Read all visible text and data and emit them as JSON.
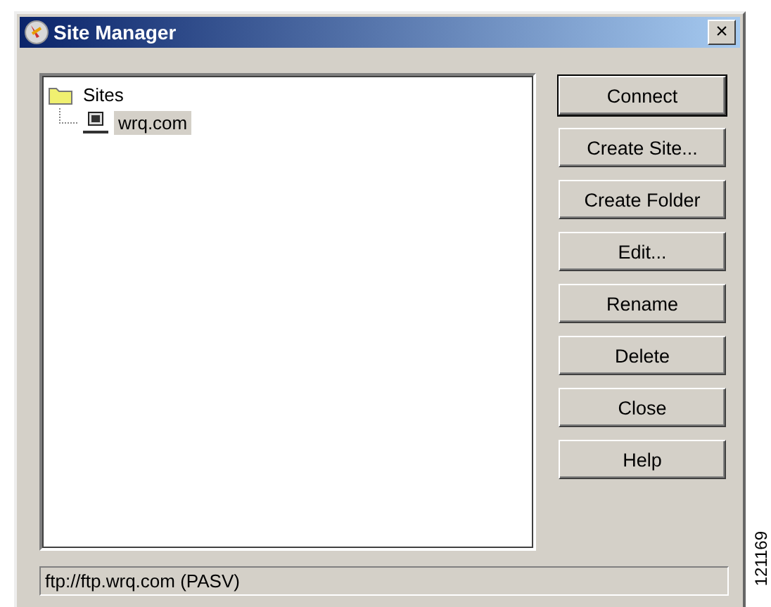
{
  "window": {
    "title": "Site Manager",
    "close_label": "×"
  },
  "tree": [
    {
      "label": "Sites",
      "kind": "folder",
      "selected": false,
      "children": [
        {
          "label": "wrq.com",
          "kind": "site",
          "selected": true
        }
      ]
    }
  ],
  "buttons": [
    {
      "label": "Connect",
      "default": true
    },
    {
      "label": "Create Site...",
      "default": false
    },
    {
      "label": "Create Folder",
      "default": false
    },
    {
      "label": "Edit...",
      "default": false
    },
    {
      "label": "Rename",
      "default": false
    },
    {
      "label": "Delete",
      "default": false
    },
    {
      "label": "Close",
      "default": false
    },
    {
      "label": "Help",
      "default": false
    }
  ],
  "status_bar": "ftp://ftp.wrq.com (PASV)",
  "figure_id": "121169"
}
